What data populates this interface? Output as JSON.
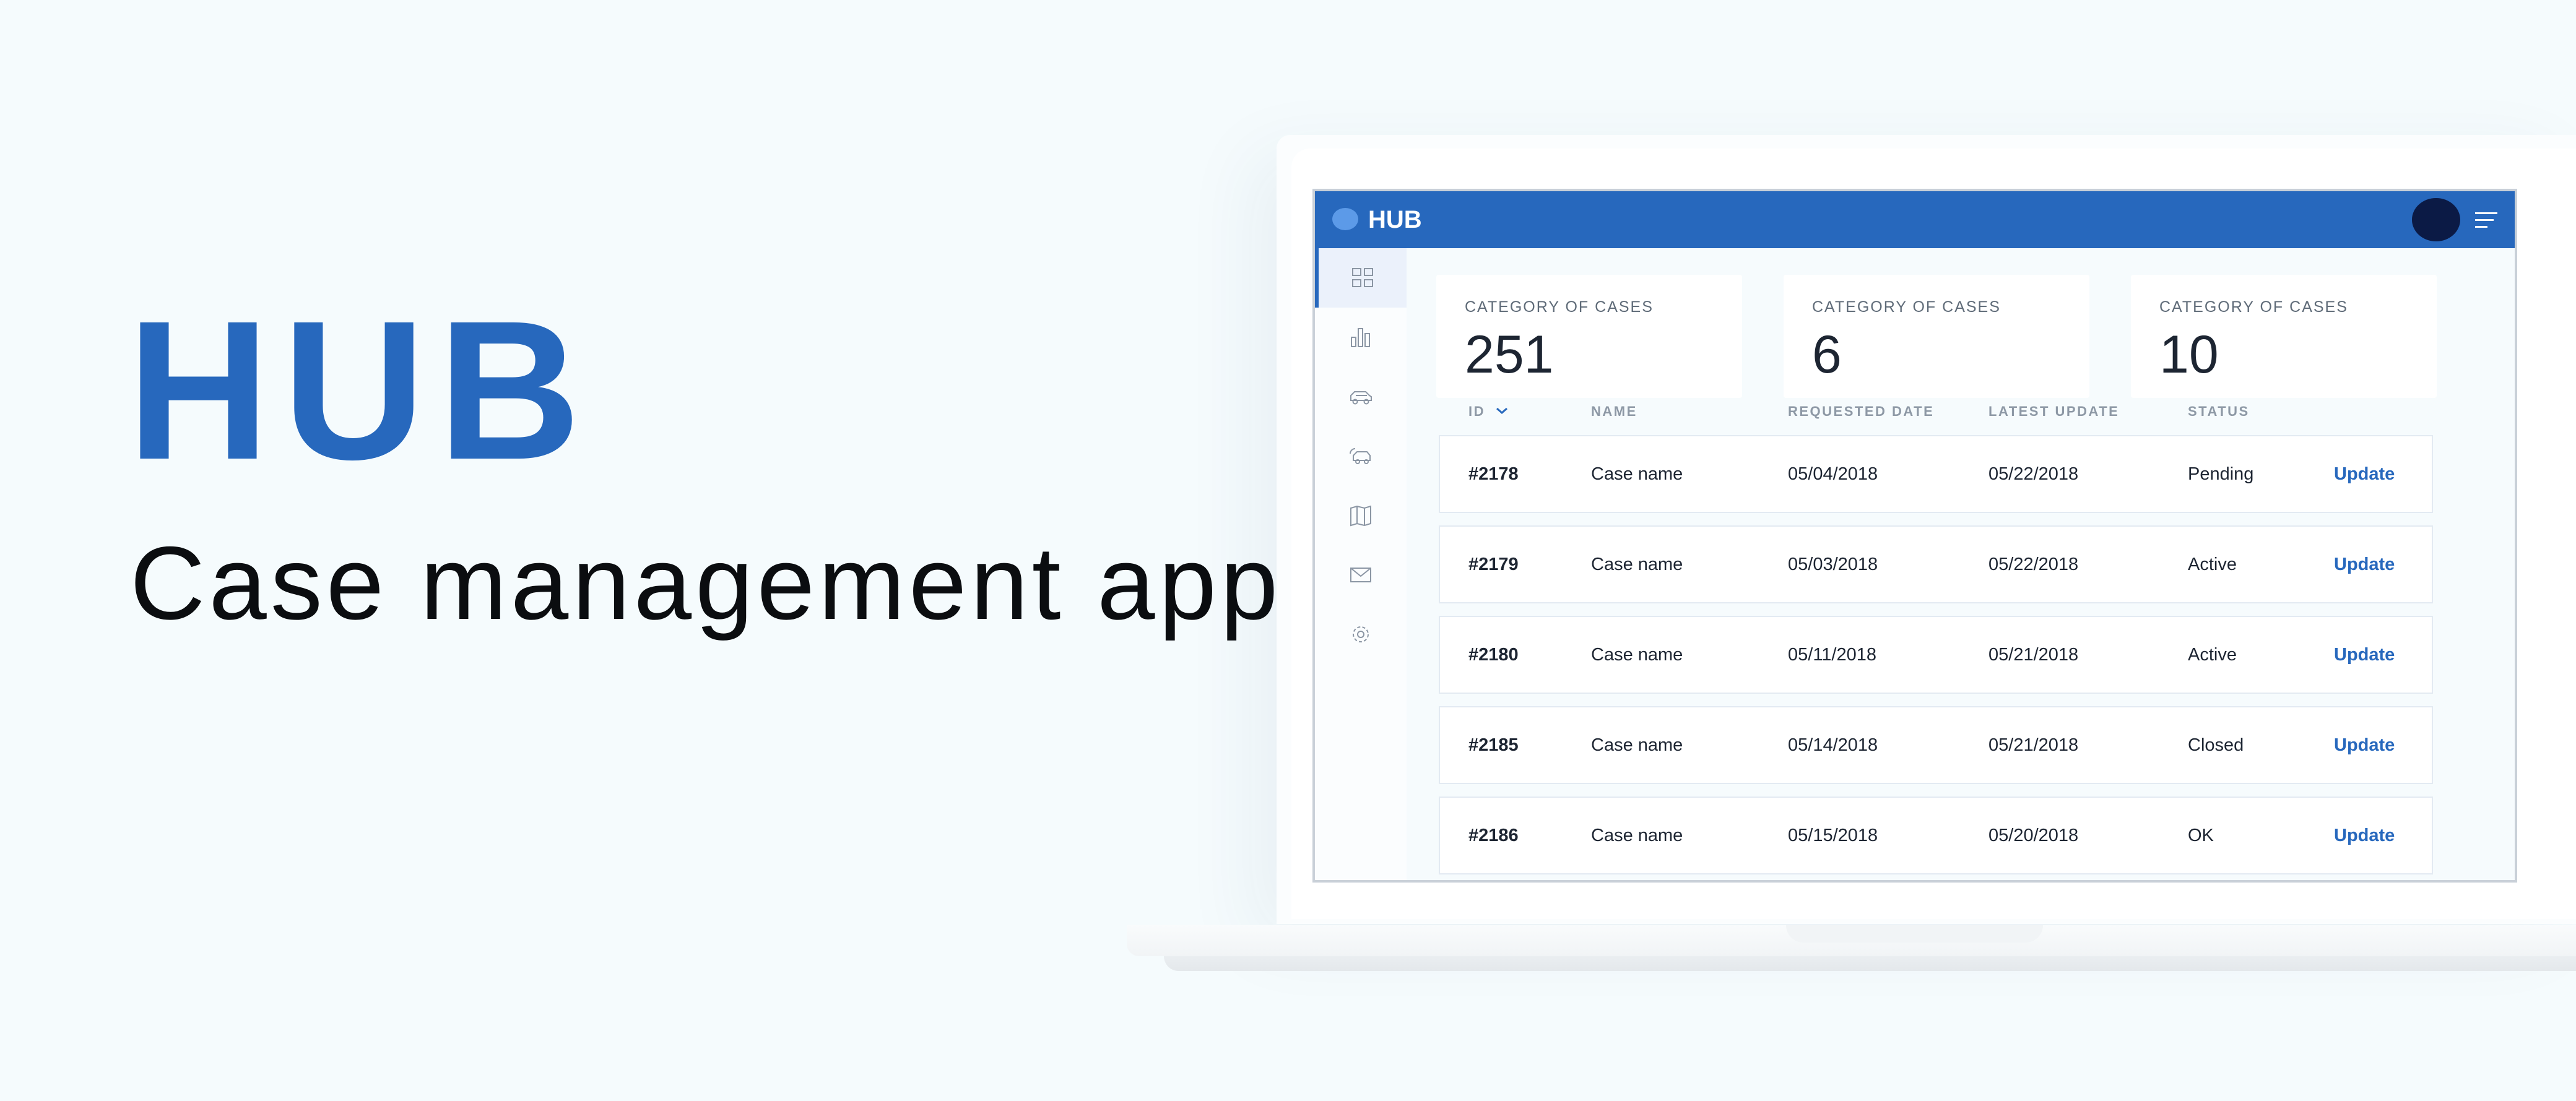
{
  "hero": {
    "title": "HUB",
    "subtitle": "Case management app"
  },
  "app": {
    "brand": "HUB",
    "brand_color": "#2768bd",
    "avatar_color": "#0b1a45"
  },
  "sidebar": {
    "items": [
      {
        "icon": "dashboard-grid-icon",
        "active": true
      },
      {
        "icon": "bar-chart-icon",
        "active": false
      },
      {
        "icon": "vehicle-icon",
        "active": false
      },
      {
        "icon": "vehicle-sync-icon",
        "active": false
      },
      {
        "icon": "map-icon",
        "active": false
      },
      {
        "icon": "mail-icon",
        "active": false
      },
      {
        "icon": "gear-icon",
        "active": false
      }
    ]
  },
  "stats": [
    {
      "label": "CATEGORY OF CASES",
      "value": "251"
    },
    {
      "label": "CATEGORY OF CASES",
      "value": "6"
    },
    {
      "label": "CATEGORY OF CASES",
      "value": "10"
    }
  ],
  "table": {
    "headers": {
      "id": "ID",
      "name": "NAME",
      "requested": "REQUESTED DATE",
      "latest": "LATEST UPDATE",
      "status": "STATUS"
    },
    "rows": [
      {
        "id": "#2178",
        "name": "Case name",
        "requested": "05/04/2018",
        "latest": "05/22/2018",
        "status": "Pending",
        "action": "Update"
      },
      {
        "id": "#2179",
        "name": "Case name",
        "requested": "05/03/2018",
        "latest": "05/22/2018",
        "status": "Active",
        "action": "Update"
      },
      {
        "id": "#2180",
        "name": "Case name",
        "requested": "05/11/2018",
        "latest": "05/21/2018",
        "status": "Active",
        "action": "Update"
      },
      {
        "id": "#2185",
        "name": "Case name",
        "requested": "05/14/2018",
        "latest": "05/21/2018",
        "status": "Closed",
        "action": "Update"
      },
      {
        "id": "#2186",
        "name": "Case name",
        "requested": "05/15/2018",
        "latest": "05/20/2018",
        "status": "OK",
        "action": "Update"
      }
    ]
  }
}
